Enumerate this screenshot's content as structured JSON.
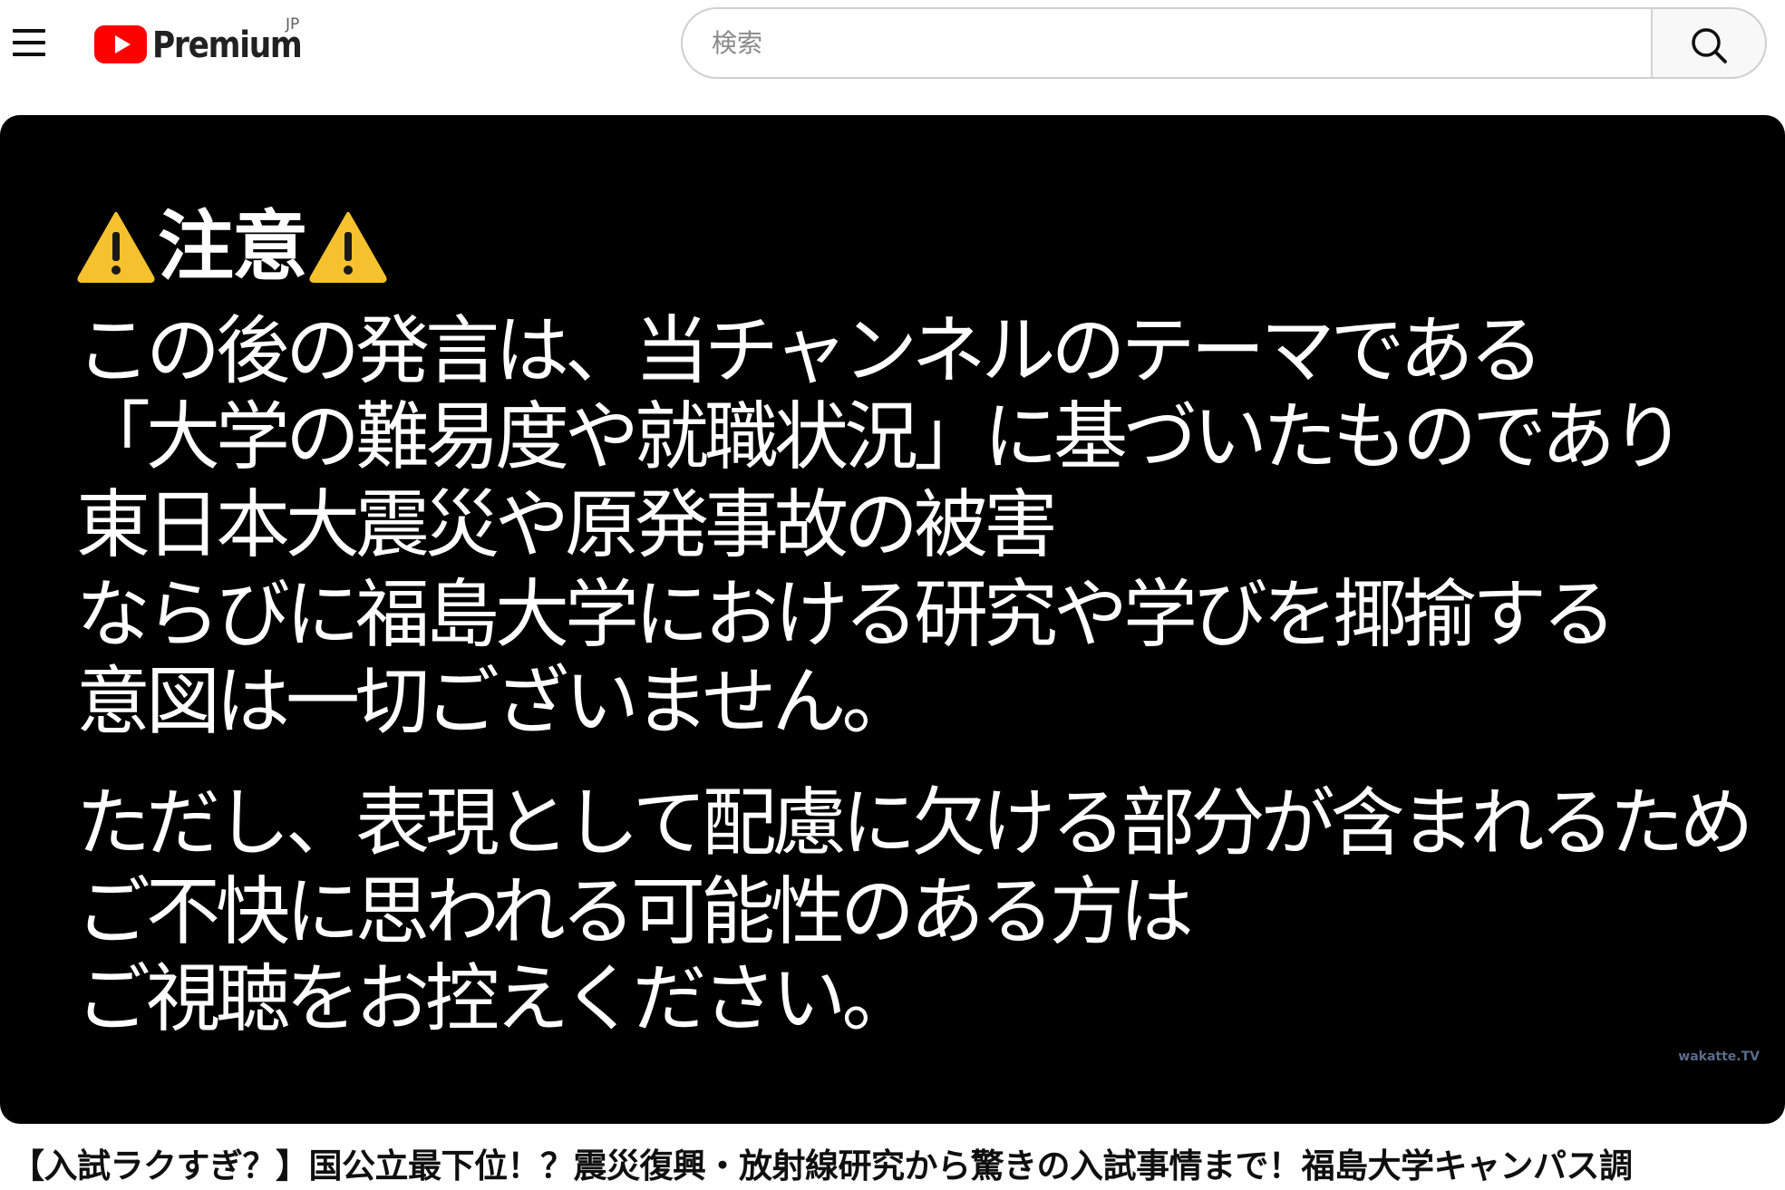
{
  "header": {
    "logo_text": "Premium",
    "logo_country": "JP",
    "search": {
      "placeholder": "検索",
      "value": ""
    }
  },
  "video": {
    "caution_title": "注意",
    "lines": [
      "この後の発言は、当チャンネルのテーマである",
      "「大学の難易度や就職状況」に基づいたものであり",
      "東日本大震災や原発事故の被害",
      "ならびに福島大学における研究や学びを揶揄する",
      "意図は一切ございません。",
      "ただし、表現として配慮に欠ける部分が含まれるため",
      "ご不快に思われる可能性のある方は",
      "ご視聴をお控えください。"
    ],
    "watermark": "wakatte.TV"
  },
  "title": "【入試ラクすぎ？】国公立最下位！？震災復興・放射線研究から驚きの入試事情まで！福島大学キャンパス調",
  "colors": {
    "brand_red": "#ff0000",
    "warning_yellow": "#f5c12e",
    "video_background": "#000000"
  },
  "icons": {
    "menu": "hamburger-menu-icon",
    "logo": "youtube-play-icon",
    "search": "search-icon",
    "warning": "warning-triangle-icon"
  }
}
